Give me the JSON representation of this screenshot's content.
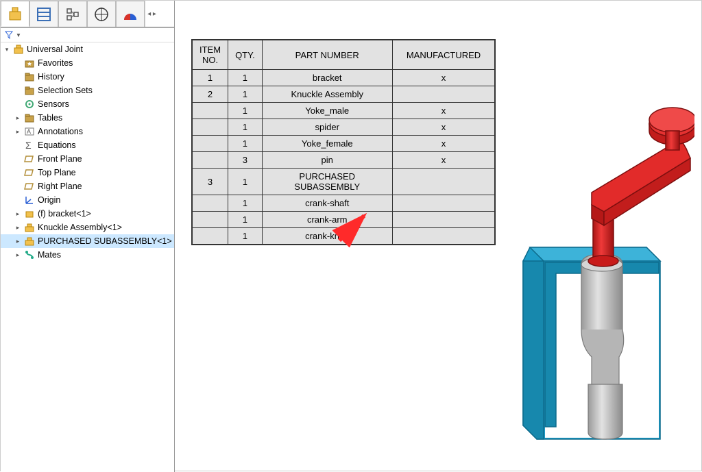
{
  "root_name": "Universal Joint",
  "tree": [
    {
      "label": "Favorites",
      "icon": "star-folder",
      "depth": 1,
      "expander": ""
    },
    {
      "label": "History",
      "icon": "folder",
      "depth": 1,
      "expander": ""
    },
    {
      "label": "Selection Sets",
      "icon": "folder",
      "depth": 1,
      "expander": ""
    },
    {
      "label": "Sensors",
      "icon": "sensor",
      "depth": 1,
      "expander": ""
    },
    {
      "label": "Tables",
      "icon": "folder",
      "depth": 1,
      "expander": "▸"
    },
    {
      "label": "Annotations",
      "icon": "annotation",
      "depth": 1,
      "expander": "▸"
    },
    {
      "label": "Equations",
      "icon": "sigma",
      "depth": 1,
      "expander": ""
    },
    {
      "label": "Front Plane",
      "icon": "plane",
      "depth": 1,
      "expander": ""
    },
    {
      "label": "Top Plane",
      "icon": "plane",
      "depth": 1,
      "expander": ""
    },
    {
      "label": "Right Plane",
      "icon": "plane",
      "depth": 1,
      "expander": ""
    },
    {
      "label": "Origin",
      "icon": "origin",
      "depth": 1,
      "expander": ""
    },
    {
      "label": "(f) bracket<1>",
      "icon": "part",
      "depth": 1,
      "expander": "▸"
    },
    {
      "label": "Knuckle Assembly<1>",
      "icon": "assembly",
      "depth": 1,
      "expander": "▸"
    },
    {
      "label": "PURCHASED SUBASSEMBLY<1>",
      "icon": "assembly",
      "depth": 1,
      "expander": "▸",
      "selected": true
    },
    {
      "label": "Mates",
      "icon": "mates",
      "depth": 1,
      "expander": "▸"
    }
  ],
  "bom": {
    "headers": {
      "item": "ITEM NO.",
      "qty": "QTY.",
      "part": "PART NUMBER",
      "mfg": "MANUFACTURED"
    },
    "rows": [
      {
        "item": "1",
        "qty": "1",
        "part": "bracket",
        "mfg": "x"
      },
      {
        "item": "2",
        "qty": "1",
        "part": "Knuckle Assembly",
        "mfg": ""
      },
      {
        "item": "",
        "qty": "1",
        "part": "Yoke_male",
        "mfg": "x"
      },
      {
        "item": "",
        "qty": "1",
        "part": "spider",
        "mfg": "x"
      },
      {
        "item": "",
        "qty": "1",
        "part": "Yoke_female",
        "mfg": "x"
      },
      {
        "item": "",
        "qty": "3",
        "part": "pin",
        "mfg": "x"
      },
      {
        "item": "3",
        "qty": "1",
        "part": "PURCHASED SUBASSEMBLY",
        "mfg": ""
      },
      {
        "item": "",
        "qty": "1",
        "part": "crank-shaft",
        "mfg": ""
      },
      {
        "item": "",
        "qty": "1",
        "part": "crank-arm",
        "mfg": ""
      },
      {
        "item": "",
        "qty": "1",
        "part": "crank-knob",
        "mfg": ""
      }
    ]
  },
  "colors": {
    "crank": "#d9201f",
    "bracket": "#1e9dc8",
    "shaft": "#b8b8b8"
  }
}
